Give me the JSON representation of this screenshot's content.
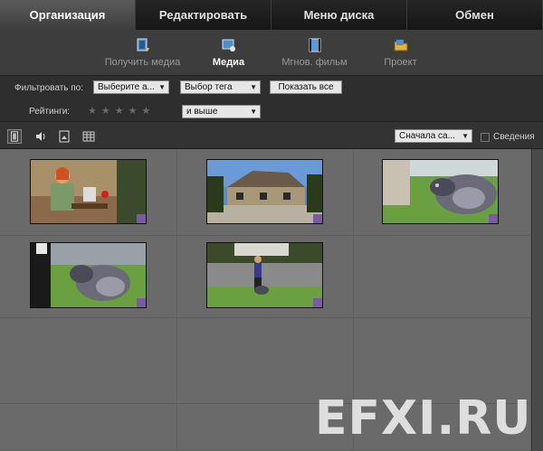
{
  "tabs": [
    "Организация",
    "Редактировать",
    "Меню диска",
    "Обмен"
  ],
  "subtabs": [
    {
      "label": "Получить медиа",
      "icon": "get-media-icon"
    },
    {
      "label": "Медиа",
      "icon": "media-icon"
    },
    {
      "label": "Мгнов. фильм",
      "icon": "instant-movie-icon"
    },
    {
      "label": "Проект",
      "icon": "project-icon"
    }
  ],
  "filters": {
    "filter_label": "Фильтровать по:",
    "filter_select": "Выберите а...",
    "tag_select": "Выбор тега",
    "show_all": "Показать все",
    "ratings_label": "Рейтинги:",
    "stars": "★★★★★",
    "ratings_select": "и выше"
  },
  "toolbar": {
    "sort_select": "Сначала са...",
    "details_label": "Сведения"
  },
  "thumbnails": [
    {
      "name": "woman-desk"
    },
    {
      "name": "house"
    },
    {
      "name": "dog-profile"
    },
    {
      "name": "dog-with-person"
    },
    {
      "name": "person-with-dog"
    }
  ],
  "watermark": "EFXI.RU"
}
